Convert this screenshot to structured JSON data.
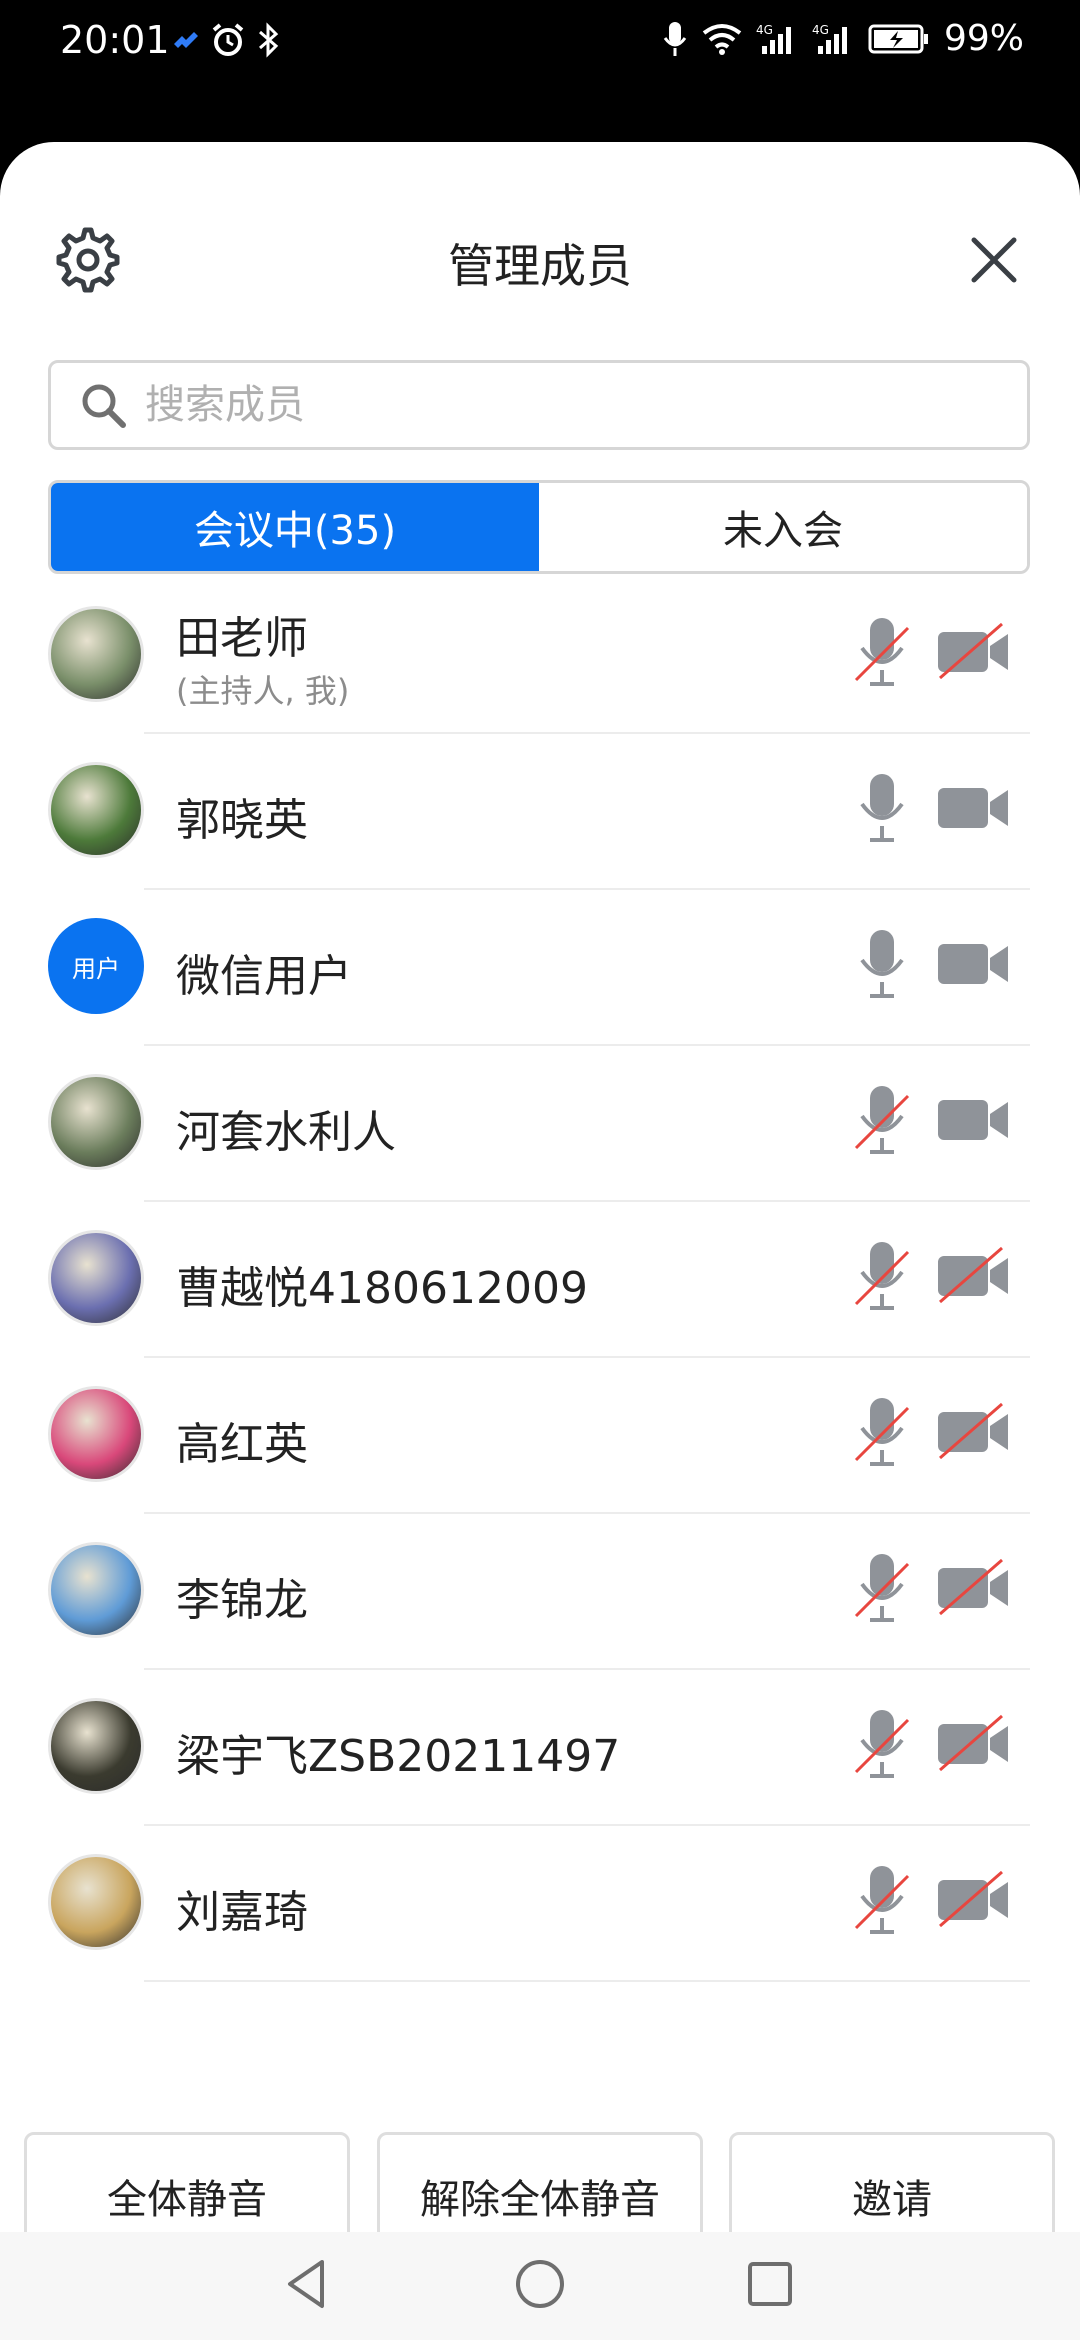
{
  "status_bar": {
    "time": "20:01",
    "battery": "99%",
    "network_left": "4G",
    "network_right": "4G"
  },
  "header": {
    "title": "管理成员"
  },
  "search": {
    "placeholder": "搜索成员"
  },
  "tabs": [
    {
      "label": "会议中(35)",
      "active": true
    },
    {
      "label": "未入会",
      "active": false
    }
  ],
  "members": [
    {
      "name": "田老师",
      "subtitle": "(主持人, 我)",
      "mic_muted": true,
      "cam_off": true
    },
    {
      "name": "郭晓英",
      "mic_muted": false,
      "cam_off": false
    },
    {
      "name": "微信用户",
      "avatar_text": "用户",
      "mic_muted": false,
      "cam_off": false
    },
    {
      "name": "河套水利人",
      "mic_muted": true,
      "cam_off": false
    },
    {
      "name": "曹越悦4180612009",
      "mic_muted": true,
      "cam_off": true
    },
    {
      "name": "高红英",
      "mic_muted": true,
      "cam_off": true
    },
    {
      "name": "李锦龙",
      "mic_muted": true,
      "cam_off": true
    },
    {
      "name": "梁宇飞ZSB20211497",
      "mic_muted": true,
      "cam_off": true
    },
    {
      "name": "刘嘉琦",
      "mic_muted": true,
      "cam_off": true
    }
  ],
  "actions": {
    "mute_all": "全体静音",
    "unmute_all": "解除全体静音",
    "invite": "邀请"
  },
  "colors": {
    "accent": "#0a73f0",
    "muted_slash": "#e8463f",
    "icon_gray": "#8f9399"
  }
}
